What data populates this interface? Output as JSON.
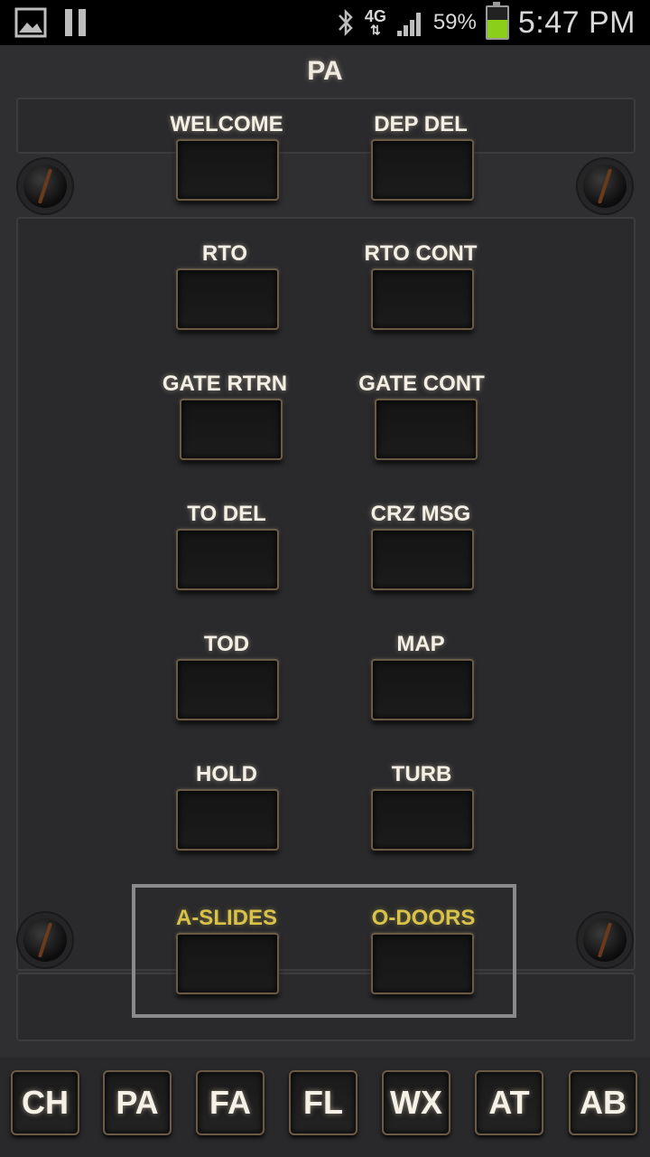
{
  "status_bar": {
    "network": "4G",
    "battery_text": "59%",
    "battery_level": 0.59,
    "time": "5:47 PM",
    "icons": [
      "gallery-icon",
      "pause-icon",
      "bluetooth-icon",
      "signal-icon",
      "battery-icon"
    ]
  },
  "panel": {
    "title": "PA",
    "buttons": [
      {
        "label": "WELCOME"
      },
      {
        "label": "DEP DEL"
      },
      {
        "label": "RTO"
      },
      {
        "label": "RTO CONT"
      },
      {
        "label": "GATE RTRN"
      },
      {
        "label": "GATE CONT"
      },
      {
        "label": "TO DEL"
      },
      {
        "label": "CRZ MSG"
      },
      {
        "label": "TOD"
      },
      {
        "label": "MAP"
      },
      {
        "label": "HOLD"
      },
      {
        "label": "TURB"
      }
    ],
    "alert_buttons": [
      {
        "label": "A-SLIDES"
      },
      {
        "label": "O-DOORS"
      }
    ],
    "label_color": "#f3efe4",
    "alert_label_color": "#d8c24a"
  },
  "tabs": [
    {
      "label": "CH"
    },
    {
      "label": "PA"
    },
    {
      "label": "FA"
    },
    {
      "label": "FL"
    },
    {
      "label": "WX"
    },
    {
      "label": "AT"
    },
    {
      "label": "AB"
    }
  ]
}
